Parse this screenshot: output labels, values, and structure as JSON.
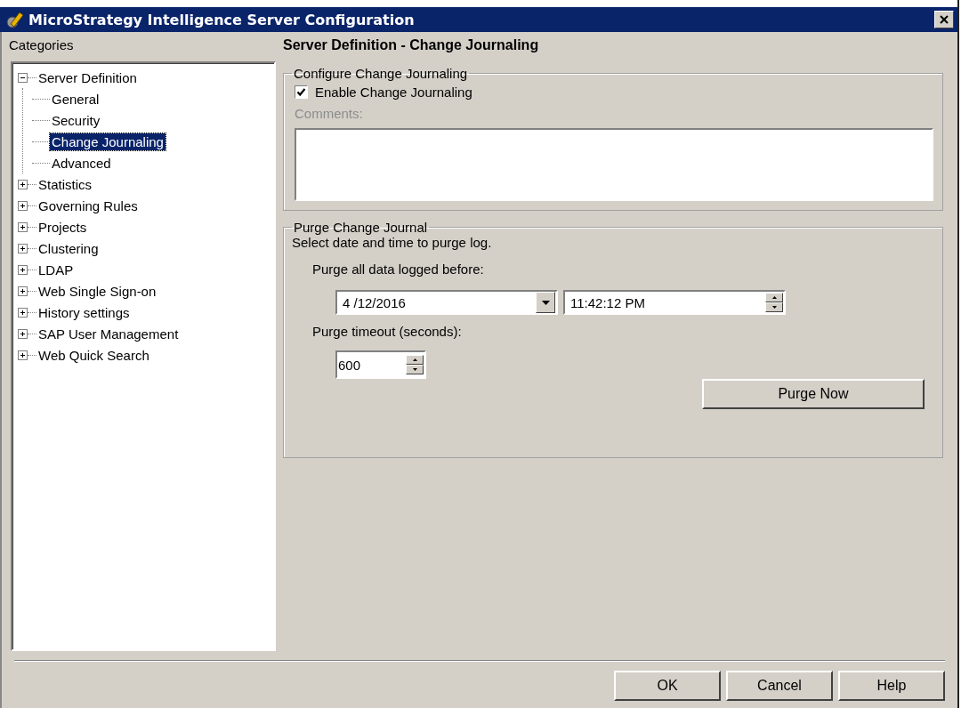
{
  "window": {
    "title": "MicroStrategy Intelligence Server Configuration"
  },
  "categories": {
    "label": "Categories",
    "tree": [
      {
        "label": "Server Definition",
        "expanded": true,
        "selected": false,
        "children": [
          {
            "label": "General",
            "selected": false
          },
          {
            "label": "Security",
            "selected": false
          },
          {
            "label": "Change Journaling",
            "selected": true
          },
          {
            "label": "Advanced",
            "selected": false
          }
        ]
      },
      {
        "label": "Statistics",
        "expanded": false,
        "selected": false
      },
      {
        "label": "Governing Rules",
        "expanded": false,
        "selected": false
      },
      {
        "label": "Projects",
        "expanded": false,
        "selected": false
      },
      {
        "label": "Clustering",
        "expanded": false,
        "selected": false
      },
      {
        "label": "LDAP",
        "expanded": false,
        "selected": false
      },
      {
        "label": "Web Single Sign-on",
        "expanded": false,
        "selected": false
      },
      {
        "label": "History settings",
        "expanded": false,
        "selected": false
      },
      {
        "label": "SAP User Management",
        "expanded": false,
        "selected": false
      },
      {
        "label": "Web Quick Search",
        "expanded": false,
        "selected": false
      }
    ]
  },
  "page_title": "Server Definition - Change Journaling",
  "configure_group": {
    "title": "Configure Change Journaling",
    "enable_checkbox": {
      "label": "Enable Change Journaling",
      "checked": true
    },
    "comments_label": "Comments:",
    "comments_disabled": true
  },
  "purge_group": {
    "title": "Purge Change Journal",
    "instruction": "Select date and time to purge log.",
    "before_label": "Purge all data logged before:",
    "date": "4 /12/2016",
    "time": "11:42:12 PM",
    "timeout_label": "Purge timeout (seconds):",
    "timeout": "600",
    "purge_button": "Purge Now"
  },
  "buttons": [
    "OK",
    "Cancel",
    "Help"
  ]
}
